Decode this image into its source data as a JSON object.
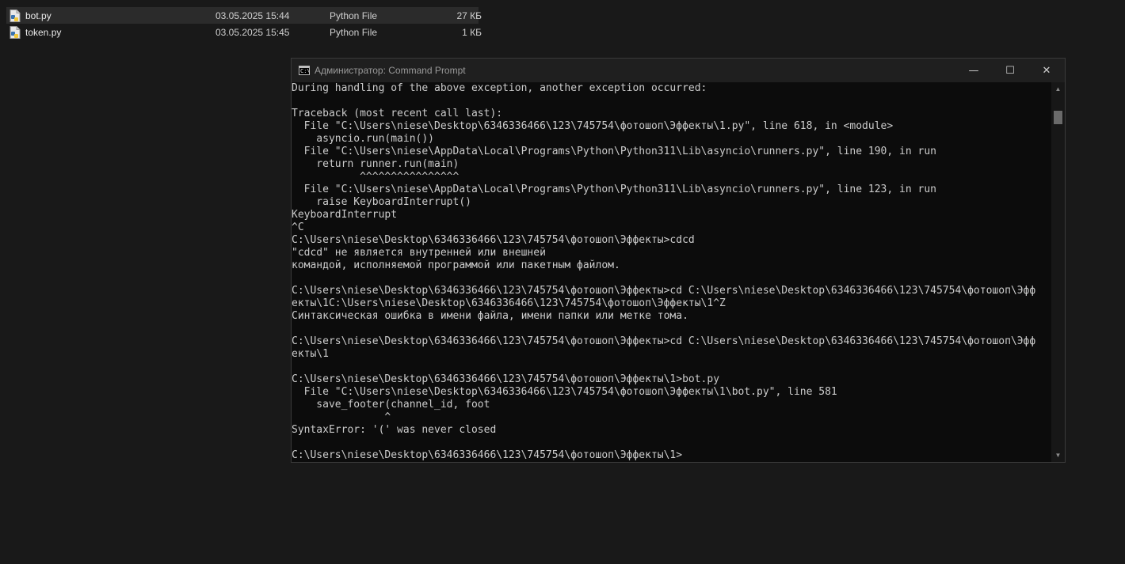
{
  "explorer": {
    "files": [
      {
        "name": "bot.py",
        "date": "03.05.2025 15:44",
        "type": "Python File",
        "size": "27 КБ",
        "selected": true
      },
      {
        "name": "token.py",
        "date": "03.05.2025 15:45",
        "type": "Python File",
        "size": "1 КБ",
        "selected": false
      }
    ],
    "file_icon": "python-file-icon"
  },
  "cmd": {
    "title": "Администратор: Command Prompt",
    "app_icon": "cmd-icon",
    "icon_glyph": "C:\\",
    "controls": {
      "minimize": "—",
      "maximize": "☐",
      "close": "✕"
    },
    "scrollbar": {
      "up_arrow": "▲",
      "down_arrow": "▼"
    },
    "lines": [
      "During handling of the above exception, another exception occurred:",
      "",
      "Traceback (most recent call last):",
      "  File \"C:\\Users\\niese\\Desktop\\6346336466\\123\\745754\\фотошоп\\Эффекты\\1.py\", line 618, in <module>",
      "    asyncio.run(main())",
      "  File \"C:\\Users\\niese\\AppData\\Local\\Programs\\Python\\Python311\\Lib\\asyncio\\runners.py\", line 190, in run",
      "    return runner.run(main)",
      "           ^^^^^^^^^^^^^^^^",
      "  File \"C:\\Users\\niese\\AppData\\Local\\Programs\\Python\\Python311\\Lib\\asyncio\\runners.py\", line 123, in run",
      "    raise KeyboardInterrupt()",
      "KeyboardInterrupt",
      "^C",
      "C:\\Users\\niese\\Desktop\\6346336466\\123\\745754\\фотошоп\\Эффекты>cdcd",
      "\"cdcd\" не является внутренней или внешней",
      "командой, исполняемой программой или пакетным файлом.",
      "",
      "C:\\Users\\niese\\Desktop\\6346336466\\123\\745754\\фотошоп\\Эффекты>cd C:\\Users\\niese\\Desktop\\6346336466\\123\\745754\\фотошоп\\Эфф",
      "екты\\1C:\\Users\\niese\\Desktop\\6346336466\\123\\745754\\фотошоп\\Эффекты\\1^Z",
      "Синтаксическая ошибка в имени файла, имени папки или метке тома.",
      "",
      "C:\\Users\\niese\\Desktop\\6346336466\\123\\745754\\фотошоп\\Эффекты>cd C:\\Users\\niese\\Desktop\\6346336466\\123\\745754\\фотошоп\\Эфф",
      "екты\\1",
      "",
      "C:\\Users\\niese\\Desktop\\6346336466\\123\\745754\\фотошоп\\Эффекты\\1>bot.py",
      "  File \"C:\\Users\\niese\\Desktop\\6346336466\\123\\745754\\фотошоп\\Эффекты\\1\\bot.py\", line 581",
      "    save_footer(channel_id, foot",
      "               ^",
      "SyntaxError: '(' was never closed",
      "",
      "C:\\Users\\niese\\Desktop\\6346336466\\123\\745754\\фотошоп\\Эффекты\\1>"
    ]
  }
}
